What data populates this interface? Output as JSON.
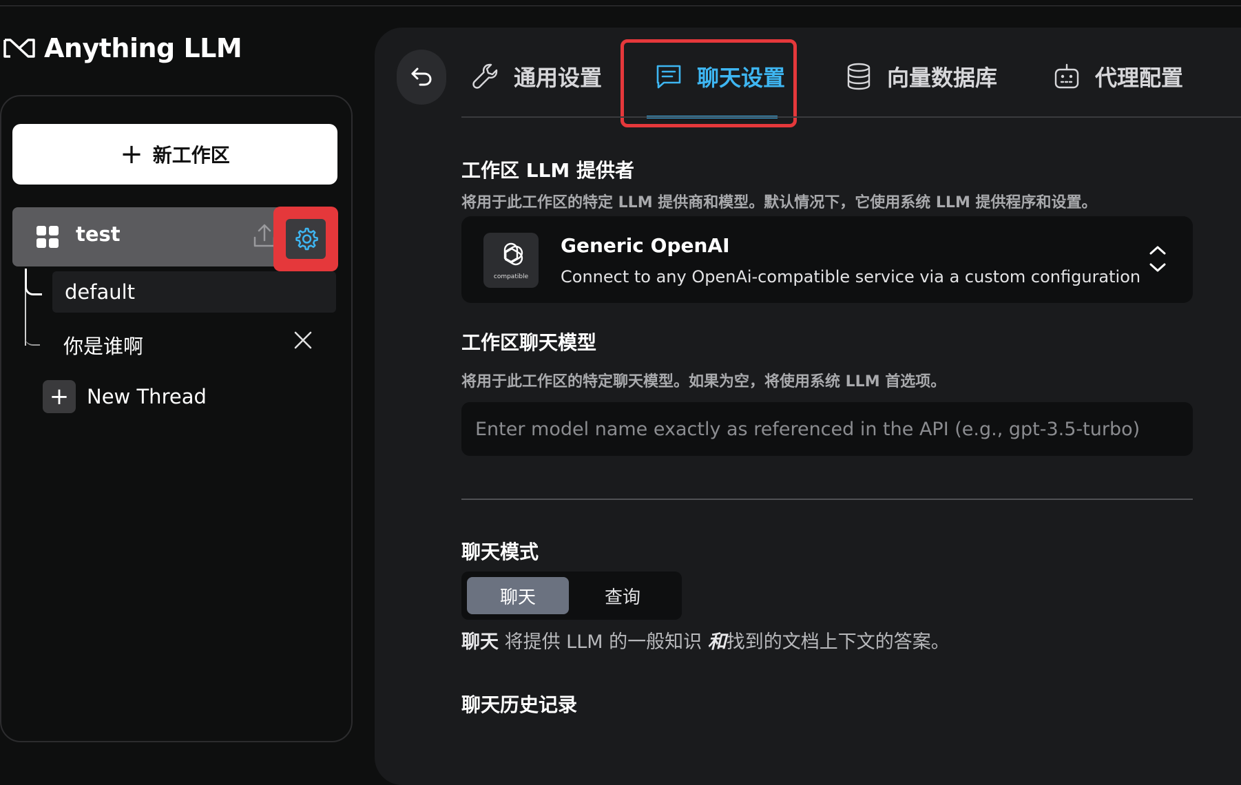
{
  "app": {
    "name": "Anything LLM"
  },
  "sidebar": {
    "new_workspace_label": "新工作区",
    "workspace": {
      "name": "test"
    },
    "threads": [
      {
        "label": "default"
      },
      {
        "label": "你是谁啊"
      }
    ],
    "new_thread_label": "New Thread"
  },
  "tabs": [
    {
      "label": "通用设置",
      "icon": "wrench-icon"
    },
    {
      "label": "聊天设置",
      "icon": "chat-icon",
      "active": true
    },
    {
      "label": "向量数据库",
      "icon": "database-icon"
    },
    {
      "label": "代理配置",
      "icon": "robot-icon"
    }
  ],
  "llm_provider": {
    "title": "工作区 LLM 提供者",
    "description": "将用于此工作区的特定 LLM 提供商和模型。默认情况下，它使用系统 LLM 提供程序和设置。",
    "selected": {
      "name": "Generic OpenAI",
      "description": "Connect to any OpenAi-compatible service via a custom configuration",
      "logo_caption": "compatible"
    }
  },
  "chat_model": {
    "title": "工作区聊天模型",
    "description": "将用于此工作区的特定聊天模型。如果为空，将使用系统 LLM 首选项。",
    "placeholder": "Enter model name exactly as referenced in the API (e.g., gpt-3.5-turbo)",
    "value": ""
  },
  "chat_mode": {
    "title": "聊天模式",
    "options": [
      "聊天",
      "查询"
    ],
    "selected": "聊天",
    "desc_prefix": "聊天",
    "desc_mid": " 将提供 LLM 的一般知识 ",
    "desc_em": "和",
    "desc_suffix": "找到的文档上下文的答案。"
  },
  "chat_history": {
    "title": "聊天历史记录"
  },
  "colors": {
    "accent": "#3eb6f2",
    "highlight": "#e5383b",
    "background": "#0e0f0f",
    "panel": "#1a1b1d"
  }
}
